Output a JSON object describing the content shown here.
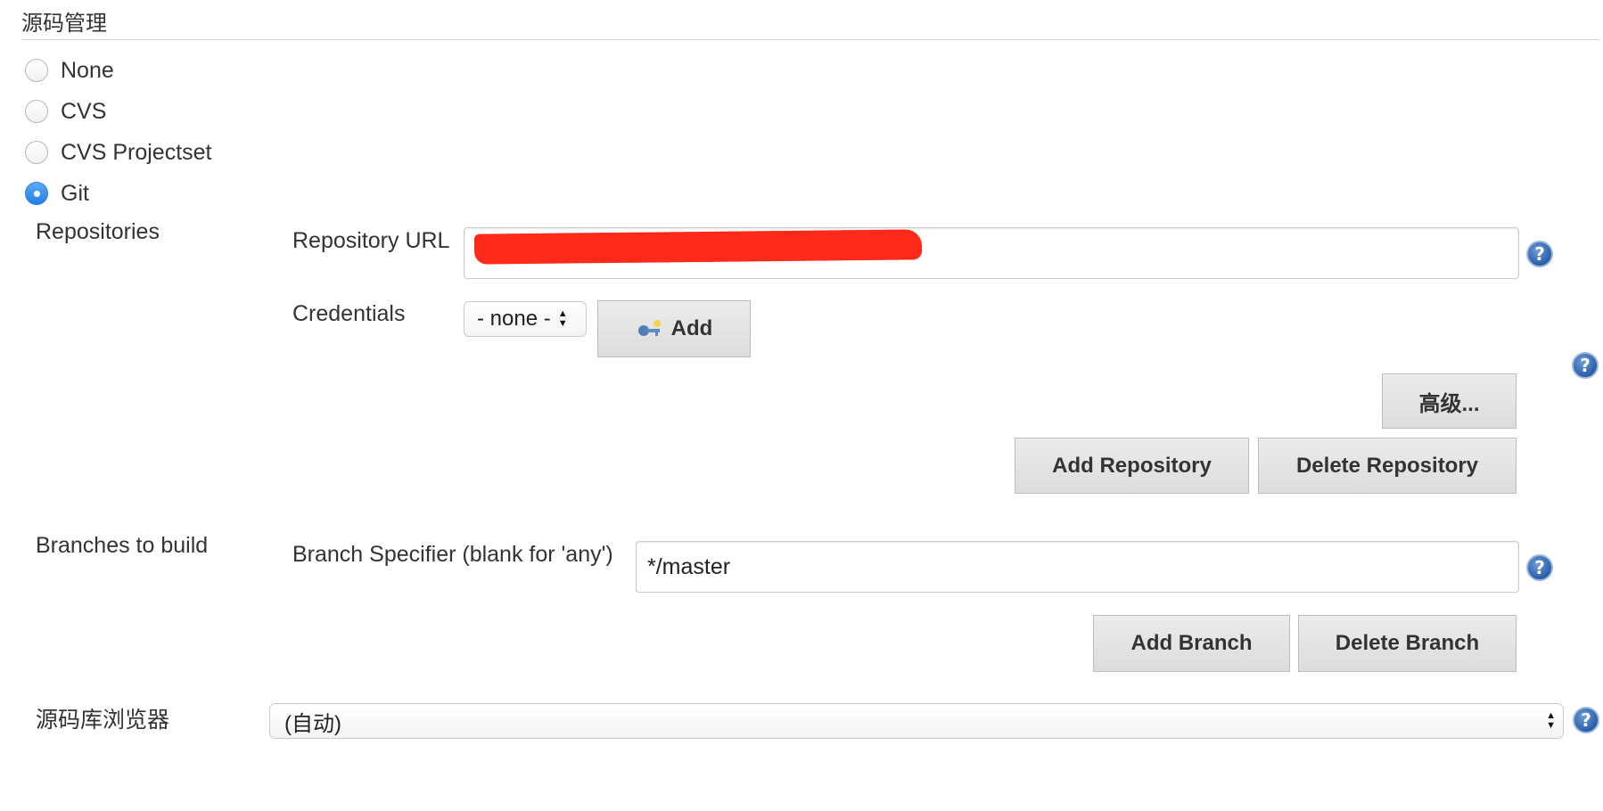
{
  "section": {
    "title": "源码管理"
  },
  "scm_options": [
    {
      "label": "None",
      "checked": false
    },
    {
      "label": "CVS",
      "checked": false
    },
    {
      "label": "CVS Projectset",
      "checked": false
    },
    {
      "label": "Git",
      "checked": true
    }
  ],
  "repositories": {
    "label": "Repositories",
    "url_label": "Repository URL",
    "url_value": "",
    "url_redaction_color": "#ff2a1a",
    "credentials_label": "Credentials",
    "credentials_selected": "- none -",
    "add_label": "Add",
    "advanced_label": "高级...",
    "add_repository_label": "Add Repository",
    "delete_repository_label": "Delete Repository"
  },
  "branches": {
    "label": "Branches to build",
    "specifier_label": "Branch Specifier (blank for 'any')",
    "specifier_value": "*/master",
    "add_branch_label": "Add Branch",
    "delete_branch_label": "Delete Branch"
  },
  "browser": {
    "label": "源码库浏览器",
    "selected": "(自动)"
  },
  "icons": {
    "help": "question-mark-help-icon",
    "credentials_add": "key-add-icon",
    "select_arrows": "updown-arrows-icon"
  },
  "colors": {
    "radio_checked": "#1f7ee8",
    "help_icon": "#2a5ea8",
    "button_bg": "#dcdcdc"
  }
}
